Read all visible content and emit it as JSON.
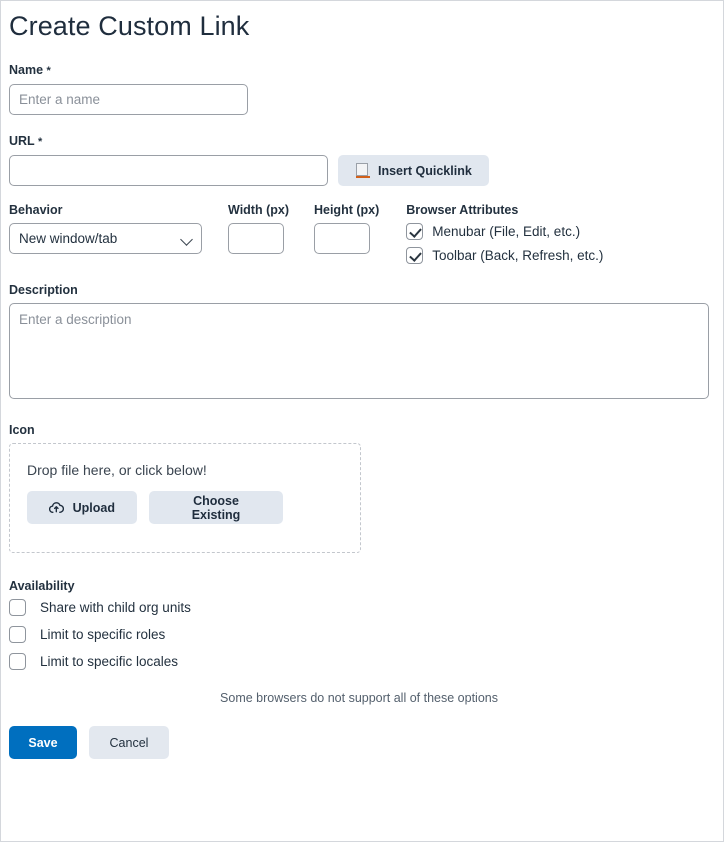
{
  "page": {
    "title": "Create Custom Link"
  },
  "name_field": {
    "label": "Name",
    "required_mark": "*",
    "placeholder": "Enter a name",
    "value": ""
  },
  "url_field": {
    "label": "URL",
    "required_mark": "*",
    "placeholder": "",
    "value": "",
    "quicklink_button": "Insert Quicklink",
    "quicklink_icon": "quicklink-page-icon"
  },
  "behavior": {
    "label": "Behavior",
    "selected": "New window/tab",
    "options": [
      "New window/tab"
    ],
    "chevron_icon": "chevron-down-icon"
  },
  "width_field": {
    "label": "Width (px)",
    "value": ""
  },
  "height_field": {
    "label": "Height (px)",
    "value": ""
  },
  "browser_attributes": {
    "label": "Browser Attributes",
    "items": [
      {
        "label": "Menubar (File, Edit, etc.)",
        "checked": true
      },
      {
        "label": "Toolbar (Back, Refresh, etc.)",
        "checked": true
      }
    ]
  },
  "description": {
    "label": "Description",
    "placeholder": "Enter a description",
    "value": ""
  },
  "icon": {
    "label": "Icon",
    "drop_text": "Drop file here, or click below!",
    "upload_button": "Upload",
    "upload_icon": "cloud-upload-icon",
    "choose_button": "Choose Existing"
  },
  "availability": {
    "label": "Availability",
    "items": [
      {
        "label": "Share with child org units",
        "checked": false
      },
      {
        "label": "Limit to specific roles",
        "checked": false
      },
      {
        "label": "Limit to specific locales",
        "checked": false
      }
    ]
  },
  "note": "Some browsers do not support all of these options",
  "footer": {
    "save_label": "Save",
    "cancel_label": "Cancel"
  },
  "colors": {
    "primary": "#006fbf",
    "secondary_bg": "#e3e8ef",
    "soft_button_bg": "#e1e7ef",
    "accent_orange": "#d2601a",
    "border": "#9a9fa6"
  }
}
